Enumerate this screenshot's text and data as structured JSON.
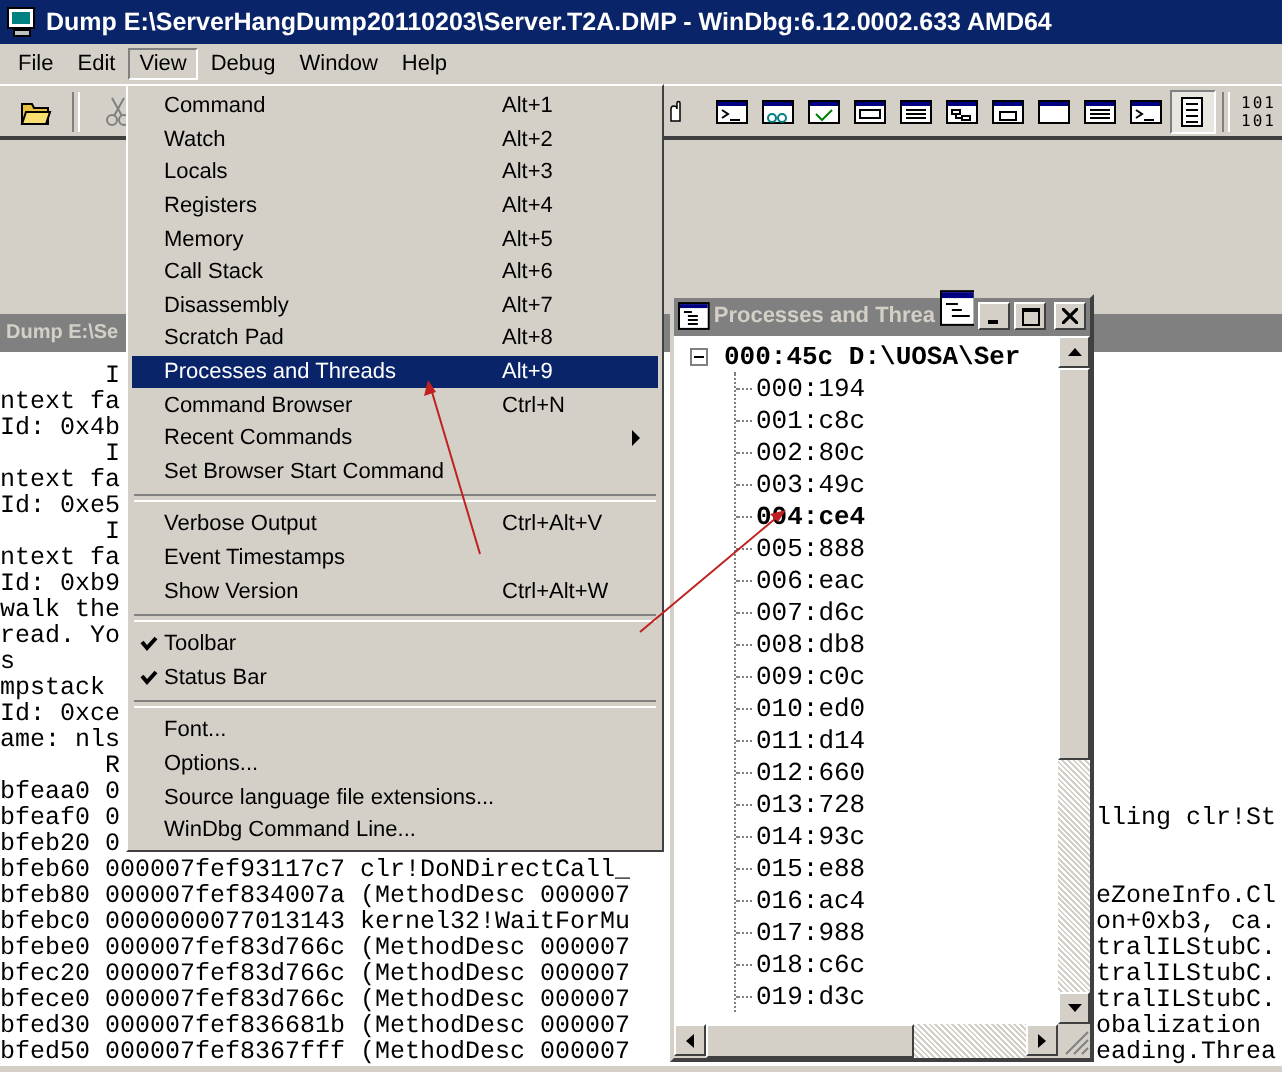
{
  "window": {
    "title": "Dump E:\\ServerHangDump20110203\\Server.T2A.DMP - WinDbg:6.12.0002.633 AMD64"
  },
  "menu_bar": [
    {
      "label": "File",
      "selected": false
    },
    {
      "label": "Edit",
      "selected": false
    },
    {
      "label": "View",
      "selected": true
    },
    {
      "label": "Debug",
      "selected": false
    },
    {
      "label": "Window",
      "selected": false
    },
    {
      "label": "Help",
      "selected": false
    }
  ],
  "toolbar": {
    "left": [
      {
        "kind": "folder",
        "pressed": false
      },
      {
        "kind": "cut",
        "pressed": false
      }
    ],
    "right": [
      {
        "kind": "hand",
        "pressed": false
      },
      {
        "kind": "console",
        "pressed": false
      },
      {
        "kind": "watch",
        "pressed": false
      },
      {
        "kind": "locals",
        "pressed": false
      },
      {
        "kind": "hex",
        "pressed": false
      },
      {
        "kind": "list",
        "pressed": false
      },
      {
        "kind": "tree",
        "pressed": false
      },
      {
        "kind": "register",
        "pressed": false
      },
      {
        "kind": "blank",
        "pressed": false
      },
      {
        "kind": "list",
        "pressed": false
      },
      {
        "kind": "console",
        "pressed": false
      },
      {
        "kind": "lines",
        "pressed": true
      }
    ],
    "mode_label": [
      "101",
      "101"
    ]
  },
  "view_menu": [
    {
      "kind": "item",
      "label": "Command",
      "shortcut": "Alt+1",
      "selected": false,
      "checked": false,
      "submenu": false
    },
    {
      "kind": "item",
      "label": "Watch",
      "shortcut": "Alt+2",
      "selected": false,
      "checked": false,
      "submenu": false
    },
    {
      "kind": "item",
      "label": "Locals",
      "shortcut": "Alt+3",
      "selected": false,
      "checked": false,
      "submenu": false
    },
    {
      "kind": "item",
      "label": "Registers",
      "shortcut": "Alt+4",
      "selected": false,
      "checked": false,
      "submenu": false
    },
    {
      "kind": "item",
      "label": "Memory",
      "shortcut": "Alt+5",
      "selected": false,
      "checked": false,
      "submenu": false
    },
    {
      "kind": "item",
      "label": "Call Stack",
      "shortcut": "Alt+6",
      "selected": false,
      "checked": false,
      "submenu": false
    },
    {
      "kind": "item",
      "label": "Disassembly",
      "shortcut": "Alt+7",
      "selected": false,
      "checked": false,
      "submenu": false
    },
    {
      "kind": "item",
      "label": "Scratch Pad",
      "shortcut": "Alt+8",
      "selected": false,
      "checked": false,
      "submenu": false
    },
    {
      "kind": "item",
      "label": "Processes and Threads",
      "shortcut": "Alt+9",
      "selected": true,
      "checked": false,
      "submenu": false
    },
    {
      "kind": "item",
      "label": "Command Browser",
      "shortcut": "Ctrl+N",
      "selected": false,
      "checked": false,
      "submenu": false
    },
    {
      "kind": "item",
      "label": "Recent Commands",
      "selected": false,
      "checked": false,
      "submenu": true
    },
    {
      "kind": "item",
      "label": "Set Browser Start Command",
      "selected": false,
      "checked": false,
      "submenu": false
    },
    {
      "kind": "separator"
    },
    {
      "kind": "item",
      "label": "Verbose Output",
      "shortcut": "Ctrl+Alt+V",
      "selected": false,
      "checked": false,
      "submenu": false
    },
    {
      "kind": "item",
      "label": "Event Timestamps",
      "selected": false,
      "checked": false,
      "submenu": false
    },
    {
      "kind": "item",
      "label": "Show Version",
      "shortcut": "Ctrl+Alt+W",
      "selected": false,
      "checked": false,
      "submenu": false
    },
    {
      "kind": "separator"
    },
    {
      "kind": "item",
      "label": "Toolbar",
      "selected": false,
      "checked": true,
      "submenu": false
    },
    {
      "kind": "item",
      "label": "Status Bar",
      "selected": false,
      "checked": true,
      "submenu": false
    },
    {
      "kind": "separator"
    },
    {
      "kind": "item",
      "label": "Font...",
      "selected": false,
      "checked": false,
      "submenu": false
    },
    {
      "kind": "item",
      "label": "Options...",
      "selected": false,
      "checked": false,
      "submenu": false
    },
    {
      "kind": "item",
      "label": "Source language file extensions...",
      "selected": false,
      "checked": false,
      "submenu": false
    },
    {
      "kind": "item",
      "label": "WinDbg Command Line...",
      "selected": false,
      "checked": false,
      "submenu": false
    }
  ],
  "command_window": {
    "title": "Dump E:\\Se",
    "lines": [
      {
        "left": "       I"
      },
      {
        "left": "ntext fa"
      },
      {
        "left": "Id: 0x4b"
      },
      {
        "left": "       I"
      },
      {
        "left": "ntext fa"
      },
      {
        "left": "Id: 0xe5"
      },
      {
        "left": "       I"
      },
      {
        "left": "ntext fa"
      },
      {
        "left": "Id: 0xb9"
      },
      {
        "left": "walk the"
      },
      {
        "left": "read. Yo"
      },
      {
        "left": "s"
      },
      {
        "left": "mpstack"
      },
      {
        "left": "Id: 0xce"
      },
      {
        "left": "ame: nls"
      },
      {
        "left": "       R"
      },
      {
        "left": "bfeaa0 0"
      },
      {
        "left": "bfeaf0 0",
        "right": "lling clr!St"
      },
      {
        "left": "bfeb20 0"
      },
      {
        "left": "bfeb60 000007fef93117c7 clr!DoNDirectCall_"
      },
      {
        "left": "bfeb80 000007fef834007a (MethodDesc 000007",
        "right": "eZoneInfo.Cl"
      },
      {
        "left": "bfebc0 0000000077013143 kernel32!WaitForMu",
        "right": "on+0xb3, ca."
      },
      {
        "left": "bfebe0 000007fef83d766c (MethodDesc 000007",
        "right": "tralILStubC."
      },
      {
        "left": "bfec20 000007fef83d766c (MethodDesc 000007",
        "right": "tralILStubC."
      },
      {
        "left": "bfece0 000007fef83d766c (MethodDesc 000007",
        "right": "tralILStubC."
      },
      {
        "left": "bfed30 000007fef836681b (MethodDesc 000007",
        "right": "obalization"
      },
      {
        "left": "bfed50 000007fef8367fff (MethodDesc 000007",
        "right": "eading.Threa"
      }
    ]
  },
  "processes_window": {
    "title": "Processes and Threa",
    "root": {
      "label": "000:45c D:\\UOSA\\Ser",
      "expanded": true,
      "current": true,
      "children": [
        {
          "label": "000:194",
          "current": false
        },
        {
          "label": "001:c8c",
          "current": false
        },
        {
          "label": "002:80c",
          "current": false
        },
        {
          "label": "003:49c",
          "current": false
        },
        {
          "label": "004:ce4",
          "current": true
        },
        {
          "label": "005:888",
          "current": false
        },
        {
          "label": "006:eac",
          "current": false
        },
        {
          "label": "007:d6c",
          "current": false
        },
        {
          "label": "008:db8",
          "current": false
        },
        {
          "label": "009:c0c",
          "current": false
        },
        {
          "label": "010:ed0",
          "current": false
        },
        {
          "label": "011:d14",
          "current": false
        },
        {
          "label": "012:660",
          "current": false
        },
        {
          "label": "013:728",
          "current": false
        },
        {
          "label": "014:93c",
          "current": false
        },
        {
          "label": "015:e88",
          "current": false
        },
        {
          "label": "016:ac4",
          "current": false
        },
        {
          "label": "017:988",
          "current": false
        },
        {
          "label": "018:c6c",
          "current": false
        },
        {
          "label": "019:d3c",
          "current": false
        }
      ]
    }
  }
}
